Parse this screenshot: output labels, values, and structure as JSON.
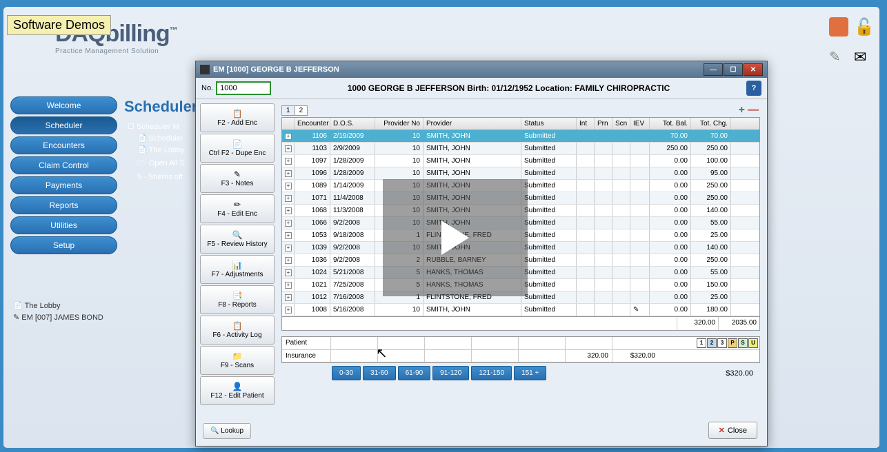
{
  "tooltip": "Software Demos",
  "logo": {
    "name": "DAQbilling",
    "tagline": "Practice Management Solution"
  },
  "nav": {
    "items": [
      "Welcome",
      "Scheduler",
      "Encounters",
      "Claim Control",
      "Payments",
      "Reports",
      "Utilities",
      "Setup"
    ],
    "active_index": 1
  },
  "scheduler_title": "Scheduler",
  "scheduler_tree": {
    "root": "Scheduler M",
    "items": [
      "Scheduler",
      "The Lobby",
      "Open All S",
      "5 - Sherris off"
    ]
  },
  "open_windows": [
    "The Lobby",
    "EM [007] JAMES BOND"
  ],
  "modal": {
    "title": "EM [1000] GEORGE B JEFFERSON",
    "no_label": "No.",
    "no_value": "1000",
    "header": "1000 GEORGE B JEFFERSON   Birth: 01/12/1952   Location: FAMILY CHIROPRACTIC",
    "tabs": [
      "1",
      "2"
    ],
    "side_buttons": [
      {
        "icon": "📋",
        "label": "F2 - Add Enc"
      },
      {
        "icon": "📄",
        "label": "Ctrl F2 - Dupe Enc"
      },
      {
        "icon": "✎",
        "label": "F3 - Notes"
      },
      {
        "icon": "✏",
        "label": "F4 - Edit Enc"
      },
      {
        "icon": "🔍",
        "label": "F5 - Review History"
      },
      {
        "icon": "📊",
        "label": "F7 - Adjustments"
      },
      {
        "icon": "📑",
        "label": "F8 - Reports"
      },
      {
        "icon": "📋",
        "label": "F6 - Activity Log"
      },
      {
        "icon": "📁",
        "label": "F9 - Scans"
      },
      {
        "icon": "👤",
        "label": "F12 - Edit Patient"
      }
    ],
    "lookup_label": "🔍 Lookup",
    "close_label": "Close",
    "columns": [
      "",
      "Encounter",
      "D.O.S.",
      "Provider No",
      "Provider",
      "Status",
      "Int",
      "Prn",
      "Scn",
      "IEV",
      "Tot. Bal.",
      "Tot. Chg."
    ],
    "rows": [
      {
        "enc": "1106",
        "dos": "2/19/2009",
        "pno": "10",
        "provider": "SMITH, JOHN",
        "status": "Submitted",
        "iev": "",
        "bal": "70.00",
        "chg": "70.00",
        "sel": true
      },
      {
        "enc": "1103",
        "dos": "2/9/2009",
        "pno": "10",
        "provider": "SMITH, JOHN",
        "status": "Submitted",
        "iev": "",
        "bal": "250.00",
        "chg": "250.00"
      },
      {
        "enc": "1097",
        "dos": "1/28/2009",
        "pno": "10",
        "provider": "SMITH, JOHN",
        "status": "Submitted",
        "iev": "",
        "bal": "0.00",
        "chg": "100.00"
      },
      {
        "enc": "1096",
        "dos": "1/28/2009",
        "pno": "10",
        "provider": "SMITH, JOHN",
        "status": "Submitted",
        "iev": "",
        "bal": "0.00",
        "chg": "95.00"
      },
      {
        "enc": "1089",
        "dos": "1/14/2009",
        "pno": "10",
        "provider": "SMITH, JOHN",
        "status": "Submitted",
        "iev": "",
        "bal": "0.00",
        "chg": "250.00"
      },
      {
        "enc": "1071",
        "dos": "11/4/2008",
        "pno": "10",
        "provider": "SMITH, JOHN",
        "status": "Submitted",
        "iev": "",
        "bal": "0.00",
        "chg": "250.00"
      },
      {
        "enc": "1068",
        "dos": "11/3/2008",
        "pno": "10",
        "provider": "SMITH, JOHN",
        "status": "Submitted",
        "iev": "",
        "bal": "0.00",
        "chg": "140.00"
      },
      {
        "enc": "1066",
        "dos": "9/2/2008",
        "pno": "10",
        "provider": "SMITH, JOHN",
        "status": "Submitted",
        "iev": "",
        "bal": "0.00",
        "chg": "55.00"
      },
      {
        "enc": "1053",
        "dos": "9/18/2008",
        "pno": "1",
        "provider": "FLINTSTONE, FRED",
        "status": "Submitted",
        "iev": "",
        "bal": "0.00",
        "chg": "25.00"
      },
      {
        "enc": "1039",
        "dos": "9/2/2008",
        "pno": "10",
        "provider": "SMITH, JOHN",
        "status": "Submitted",
        "iev": "",
        "bal": "0.00",
        "chg": "140.00"
      },
      {
        "enc": "1036",
        "dos": "9/2/2008",
        "pno": "2",
        "provider": "RUBBLE, BARNEY",
        "status": "Submitted",
        "iev": "",
        "bal": "0.00",
        "chg": "250.00"
      },
      {
        "enc": "1024",
        "dos": "5/21/2008",
        "pno": "5",
        "provider": "HANKS, THOMAS",
        "status": "Submitted",
        "iev": "",
        "bal": "0.00",
        "chg": "55.00"
      },
      {
        "enc": "1021",
        "dos": "7/25/2008",
        "pno": "5",
        "provider": "HANKS, THOMAS",
        "status": "Submitted",
        "iev": "",
        "bal": "0.00",
        "chg": "150.00"
      },
      {
        "enc": "1012",
        "dos": "7/16/2008",
        "pno": "1",
        "provider": "FLINTSTONE, FRED",
        "status": "Submitted",
        "iev": "",
        "bal": "0.00",
        "chg": "25.00"
      },
      {
        "enc": "1008",
        "dos": "5/16/2008",
        "pno": "10",
        "provider": "SMITH, JOHN",
        "status": "Submitted",
        "iev": "✎",
        "bal": "0.00",
        "chg": "180.00"
      }
    ],
    "totals": {
      "bal": "320.00",
      "chg": "2035.00"
    },
    "summary": {
      "patient_label": "Patient",
      "insurance_label": "Insurance",
      "patient_cells": [
        "",
        "",
        "",
        "",
        "",
        "",
        ""
      ],
      "insurance_cells": [
        "",
        "",
        "",
        "",
        "",
        "320.00",
        "$320.00"
      ],
      "badges": [
        "1",
        "2",
        "3",
        "P",
        "S",
        "U"
      ]
    },
    "aging": {
      "buttons": [
        "0-30",
        "31-60",
        "61-90",
        "91-120",
        "121-150",
        "151 +"
      ],
      "total": "$320.00"
    }
  }
}
